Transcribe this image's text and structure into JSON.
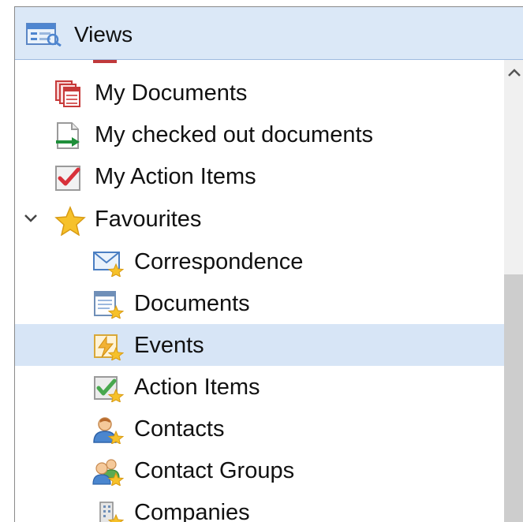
{
  "header": {
    "title": "Views",
    "icon": "views-list-icon"
  },
  "tree": {
    "items": [
      {
        "label": "My Documents",
        "icon": "documents-stack-icon"
      },
      {
        "label": "My checked out documents",
        "icon": "checked-out-document-icon"
      },
      {
        "label": "My Action Items",
        "icon": "action-item-check-icon"
      },
      {
        "label": "Favourites",
        "icon": "star-icon",
        "expanded": true
      },
      {
        "label": "Correspondence",
        "icon": "envelope-star-icon"
      },
      {
        "label": "Documents",
        "icon": "document-star-icon"
      },
      {
        "label": "Events",
        "icon": "event-star-icon",
        "selected": true
      },
      {
        "label": "Action Items",
        "icon": "check-star-icon"
      },
      {
        "label": "Contacts",
        "icon": "contact-star-icon"
      },
      {
        "label": "Contact Groups",
        "icon": "contact-group-star-icon"
      },
      {
        "label": "Companies",
        "icon": "company-star-icon"
      }
    ]
  },
  "colors": {
    "header_bg": "#dbe8f7",
    "selected_bg": "#d7e5f6",
    "scrollbar_thumb": "#cdcdcd"
  }
}
